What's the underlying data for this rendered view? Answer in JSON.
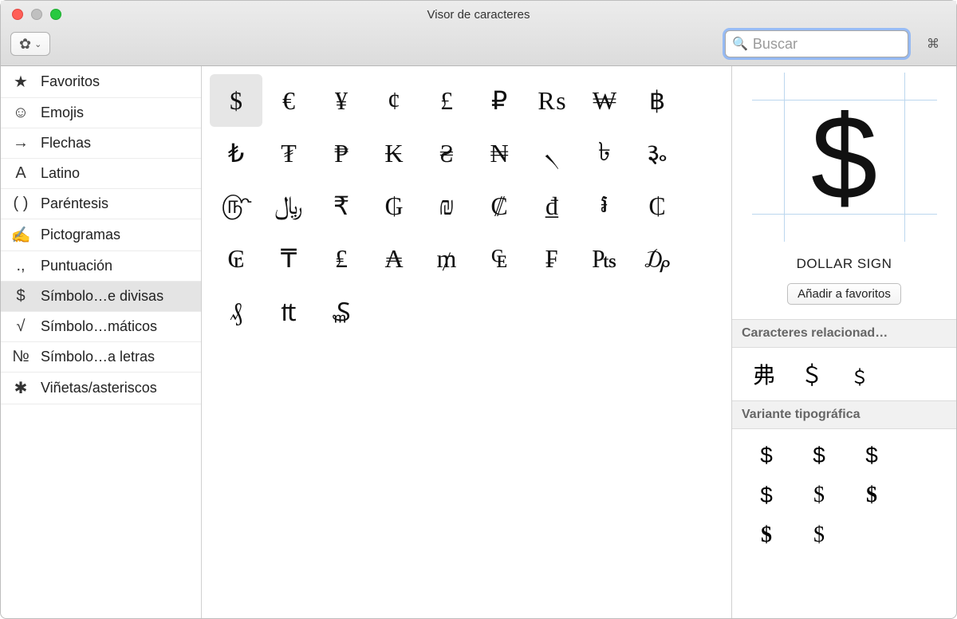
{
  "window": {
    "title": "Visor de caracteres"
  },
  "toolbar": {
    "search_placeholder": "Buscar"
  },
  "sidebar": {
    "items": [
      {
        "icon": "★",
        "label": "Favoritos"
      },
      {
        "icon": "☺",
        "label": "Emojis"
      },
      {
        "icon": "→",
        "label": "Flechas"
      },
      {
        "icon": "A",
        "label": "Latino"
      },
      {
        "icon": "( )",
        "label": "Paréntesis"
      },
      {
        "icon": "✍",
        "label": "Pictogramas"
      },
      {
        "icon": ".,",
        "label": "Puntuación"
      },
      {
        "icon": "$",
        "label": "Símbolo…e divisas"
      },
      {
        "icon": "√",
        "label": "Símbolo…máticos"
      },
      {
        "icon": "№",
        "label": "Símbolo…a letras"
      },
      {
        "icon": "✱",
        "label": "Viñetas/asteriscos"
      }
    ],
    "selected_index": 7
  },
  "grid": {
    "selected_index": 0,
    "chars": [
      "$",
      "€",
      "¥",
      "¢",
      "£",
      "₽",
      "₨",
      "₩",
      "฿",
      "₺",
      "₮",
      "₱",
      "₭",
      "₴",
      "₦",
      "৲",
      "৳",
      "૱",
      "௹",
      "﷼",
      "₹",
      "₲",
      "₪",
      "₡",
      "₫",
      "៛",
      "₵",
      "₢",
      "₸",
      "₤",
      "₳",
      "₥",
      "₠",
      "₣",
      "₧",
      "₯",
      "₰",
      "₶",
      "₷"
    ]
  },
  "detail": {
    "glyph": "$",
    "name": "DOLLAR SIGN",
    "add_favorite_label": "Añadir a favoritos",
    "related_header": "Caracteres relacionad…",
    "related": [
      "弗",
      "＄",
      "﹩"
    ],
    "variant_header": "Variante tipográfica",
    "variants": [
      "$",
      "$",
      "$",
      "$",
      "$",
      "$",
      "$",
      "$"
    ]
  }
}
